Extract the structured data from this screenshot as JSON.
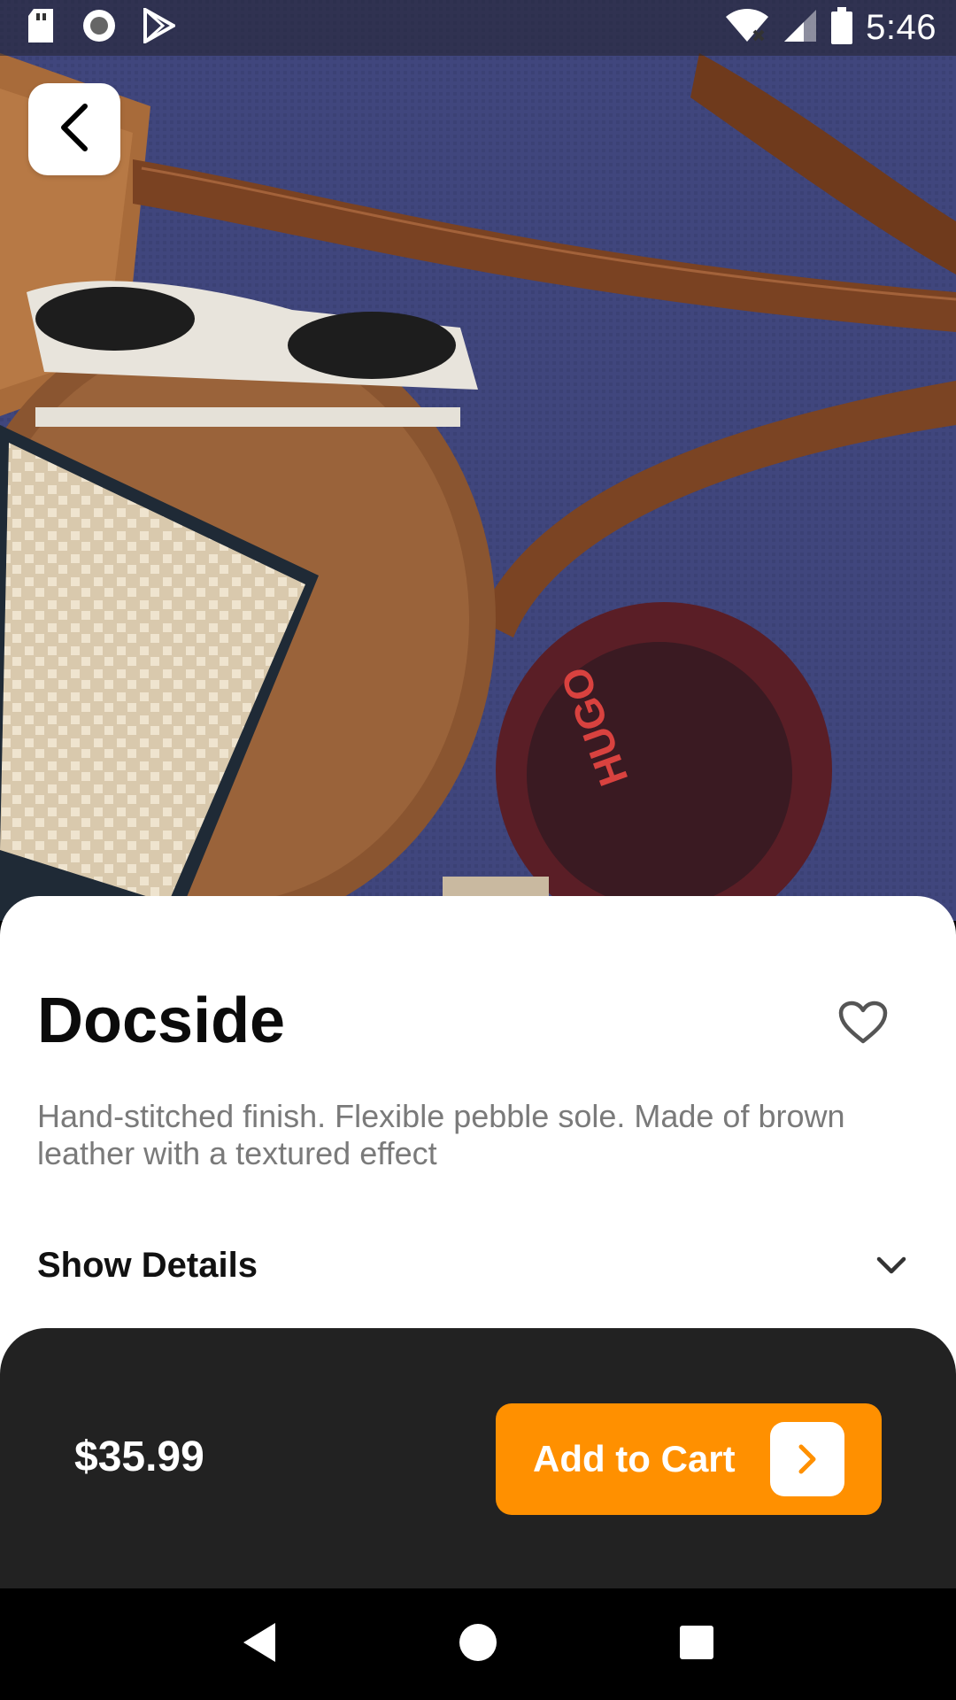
{
  "status_bar": {
    "time": "5:46",
    "icons": [
      "sd-card-icon",
      "circle-notification-icon",
      "play-store-icon",
      "wifi-icon",
      "signal-icon",
      "battery-icon"
    ]
  },
  "hero": {
    "image": "product-photo",
    "description_icons": [
      "back-icon"
    ]
  },
  "product": {
    "title": "Docside",
    "description": "Hand-stitched finish. Flexible pebble sole. Made of brown leather with a textured effect",
    "details_label": "Show Details"
  },
  "cart": {
    "price": "$35.99",
    "button_label": "Add to Cart"
  },
  "nav_bar": {
    "buttons": [
      "back-triangle-icon",
      "home-circle-icon",
      "recents-square-icon"
    ]
  },
  "colors": {
    "accent": "#ff9000",
    "cart_bar": "#222222",
    "description_text": "#7a7a7a"
  }
}
